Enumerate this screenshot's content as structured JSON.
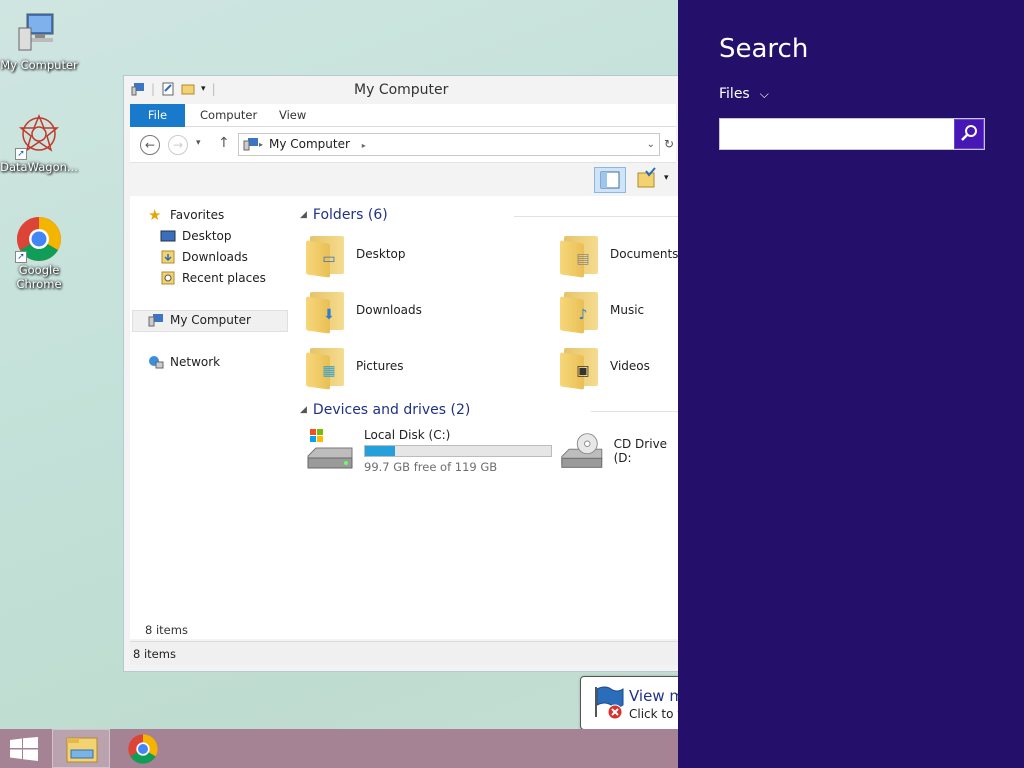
{
  "desktop": {
    "icons": [
      {
        "label": "My Computer",
        "icon": "computer-icon"
      },
      {
        "label": "DataWagon...",
        "icon": "datawagon-icon"
      },
      {
        "label": "Google Chrome",
        "icon": "chrome-icon"
      }
    ]
  },
  "explorer": {
    "title": "My Computer",
    "tabs": {
      "file": "File",
      "computer": "Computer",
      "view": "View"
    },
    "address": {
      "path": "My Computer"
    },
    "nav": {
      "favorites": "Favorites",
      "desktop": "Desktop",
      "downloads": "Downloads",
      "recent": "Recent places",
      "computer": "My Computer",
      "network": "Network"
    },
    "groups": {
      "folders": "Folders (6)",
      "devices": "Devices and drives (2)"
    },
    "folders": [
      {
        "label": "Desktop"
      },
      {
        "label": "Documents"
      },
      {
        "label": "Downloads"
      },
      {
        "label": "Music"
      },
      {
        "label": "Pictures"
      },
      {
        "label": "Videos"
      }
    ],
    "drives": {
      "local": {
        "label": "Local Disk (C:)",
        "free_text": "99.7 GB free of 119 GB",
        "used_fraction": 0.16
      },
      "cd": {
        "label": "CD Drive (D:"
      }
    },
    "item_count_inner": "8 items",
    "status": "8 items"
  },
  "toast": {
    "title": "View m",
    "subtitle": "Click to v"
  },
  "charm": {
    "title": "Search",
    "scope": "Files",
    "search_value": "",
    "accent": "#24106b"
  },
  "taskbar": {
    "color": "#a58394"
  }
}
